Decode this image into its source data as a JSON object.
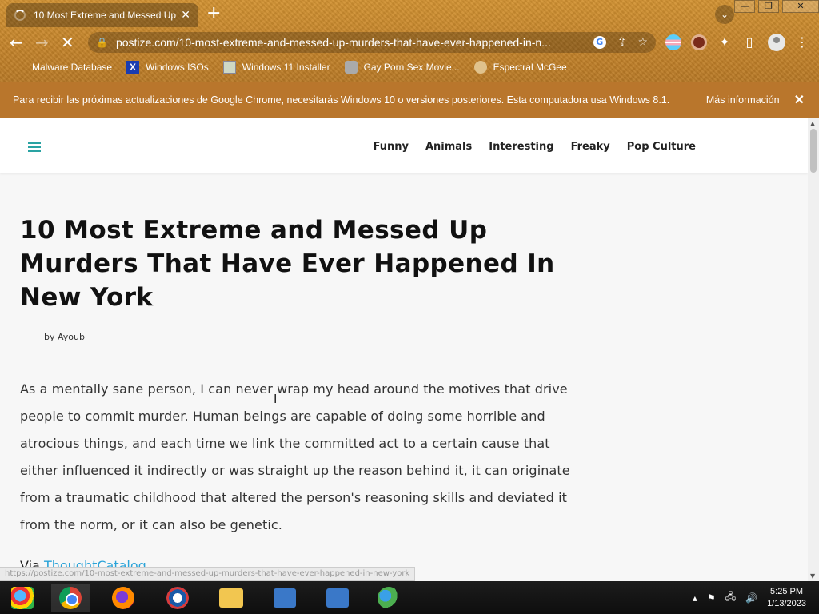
{
  "browser": {
    "tab_title": "10 Most Extreme and Messed Up",
    "tab_close": "✕",
    "new_tab": "+",
    "url": "postize.com/10-most-extreme-and-messed-up-murders-that-have-ever-happened-in-n...",
    "bookmarks": [
      {
        "label": "Malware Database",
        "icon": "blank-page-icon"
      },
      {
        "label": "Windows ISOs",
        "icon": "x-logo-icon"
      },
      {
        "label": "Windows 11 Installer",
        "icon": "image-icon"
      },
      {
        "label": "Gay Porn Sex Movie...",
        "icon": "cube-icon"
      },
      {
        "label": "Espectral McGee",
        "icon": "face-icon"
      }
    ]
  },
  "infobar": {
    "message": "Para recibir las próximas actualizaciones de Google Chrome, necesitarás Windows 10 o versiones posteriores. Esta computadora usa Windows 8.1.",
    "link": "Más información",
    "close": "✕"
  },
  "site": {
    "nav": [
      "Funny",
      "Animals",
      "Interesting",
      "Freaky",
      "Pop Culture"
    ]
  },
  "article": {
    "title": "10 Most Extreme and Messed Up Murders That Have Ever Happened In New York",
    "byline": "by Ayoub",
    "body": "As a mentally sane person, I can never wrap my head around the motives that drive people to commit murder. Human beings are capable of doing some horrible and atrocious things, and each time we link the committed act to a certain cause that either influenced it indirectly or was straight up the reason behind it, it can originate from a traumatic childhood that altered the person's reasoning skills and deviated it from the norm, or it can also be genetic.",
    "via_prefix": "Via",
    "via_link": "ThoughtCatalog"
  },
  "status_url": "https://postize.com/10-most-extreme-and-messed-up-murders-that-have-ever-happened-in-new-york",
  "taskbar": {
    "time": "5:25 PM",
    "date": "1/13/2023"
  },
  "colors": {
    "chrome_theme": "#c98a2a",
    "infobar": "#b9762c",
    "accent": "#2aa3a3",
    "link": "#2aa3d8"
  }
}
